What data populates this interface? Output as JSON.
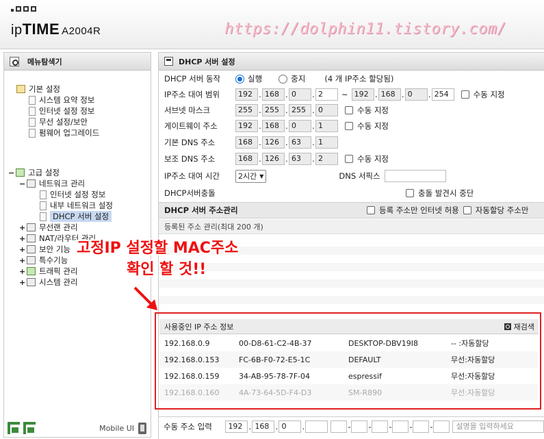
{
  "header": {
    "logo_prefix": "ip",
    "logo_brand": "TIME",
    "model": "A2004R",
    "watermark": "https://dolphin11.tistory.com/"
  },
  "sidebar": {
    "title": "메뉴탐색기",
    "basic": {
      "label": "기본 설정",
      "items": [
        "시스템 요약 정보",
        "인터넷 설정 정보",
        "무선 설정/보안",
        "펌웨어 업그레이드"
      ]
    },
    "advanced": {
      "label": "고급 설정",
      "network": "네트워크 관리",
      "network_items": [
        "인터넷 설정 정보",
        "내부 네트워크 설정",
        "DHCP 서버 설정"
      ],
      "others": [
        "무선랜 관리",
        "NAT/라우터 관리",
        "보안 기능",
        "특수기능",
        "트래픽 관리",
        "시스템 관리"
      ]
    },
    "mobile_ui": "Mobile UI",
    "expand_minus": "−",
    "expand_plus": "+"
  },
  "dhcp": {
    "title": "DHCP 서버 설정",
    "op_label": "DHCP 서버 동작",
    "op_on": "실행",
    "op_off": "중지",
    "op_note": "(4 개 IP주소 할당됨)",
    "range_label": "IP주소 대여 범위",
    "range_start": [
      "192",
      "168",
      "0",
      "2"
    ],
    "range_sep": "~",
    "range_end": [
      "192",
      "168",
      "0",
      "254"
    ],
    "manual": "수동 지정",
    "subnet_label": "서브넷 마스크",
    "subnet": [
      "255",
      "255",
      "255",
      "0"
    ],
    "gateway_label": "게이트웨이 주소",
    "gateway": [
      "192",
      "168",
      "0",
      "1"
    ],
    "dns1_label": "기본 DNS 주소",
    "dns1": [
      "168",
      "126",
      "63",
      "1"
    ],
    "dns2_label": "보조 DNS 주소",
    "dns2": [
      "168",
      "126",
      "63",
      "2"
    ],
    "lease_label": "IP주소 대여 시간",
    "lease_value": "2시간",
    "dns_suffix_label": "DNS 서픽스",
    "conflict_label": "DHCP서버충돌",
    "conflict_option": "충돌 발견시 중단"
  },
  "addr_mgmt": {
    "title": "DHCP 서버 주소관리",
    "opt1": "등록 주소만 인터넷 허용",
    "opt2": "자동할당 주소만",
    "registered": "등록된 주소 관리(최대 200 개)"
  },
  "in_use": {
    "title": "사용중인 IP 주소 정보",
    "rescan": "재검색",
    "rows": [
      {
        "ip": "192.168.0.9",
        "mac": "00-D8-61-C2-4B-37",
        "name": "DESKTOP-DBV19I8",
        "type": "-- :자동할당"
      },
      {
        "ip": "192.168.0.153",
        "mac": "FC-6B-F0-72-E5-1C",
        "name": "DEFAULT",
        "type": "무선:자동할당"
      },
      {
        "ip": "192.168.0.159",
        "mac": "34-AB-95-78-7F-04",
        "name": "espressif",
        "type": "무선:자동할당"
      },
      {
        "ip": "192.168.0.160",
        "mac": "4A-73-64-5D-F4-D3",
        "name": "SM-R890",
        "type": "무선:자동할당"
      }
    ]
  },
  "manual_entry": {
    "label": "수동 주소 입력",
    "ip": [
      "192",
      "168",
      "0",
      ""
    ],
    "memo_placeholder": "설명을 입력하세요"
  },
  "annotation": {
    "line1": "고정IP 설정할 MAC주소",
    "line2": "확인 할 것!!"
  }
}
